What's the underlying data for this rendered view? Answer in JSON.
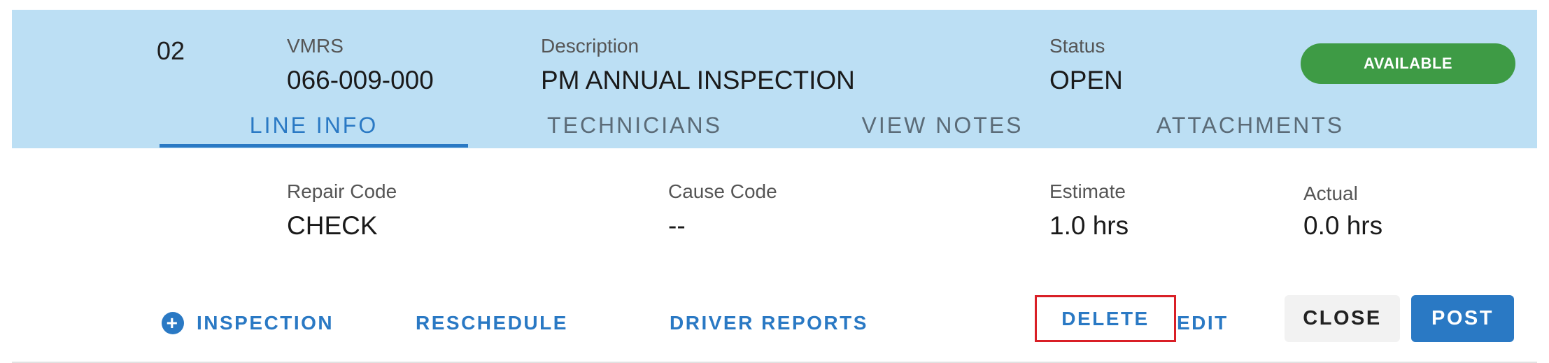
{
  "line": {
    "number": "02",
    "vmrs_label": "VMRS",
    "vmrs_value": "066-009-000",
    "description_label": "Description",
    "description_value": "PM ANNUAL INSPECTION",
    "status_label": "Status",
    "status_value": "OPEN",
    "availability_badge": "AVAILABLE"
  },
  "tabs": [
    {
      "label": "LINE INFO",
      "active": true
    },
    {
      "label": "TECHNICIANS",
      "active": false
    },
    {
      "label": "VIEW NOTES",
      "active": false
    },
    {
      "label": "ATTACHMENTS",
      "active": false
    }
  ],
  "details": {
    "repair_code_label": "Repair Code",
    "repair_code_value": "CHECK",
    "cause_code_label": "Cause Code",
    "cause_code_value": "--",
    "estimate_label": "Estimate",
    "estimate_value": "1.0 hrs",
    "actual_label": "Actual",
    "actual_value": "0.0 hrs"
  },
  "actions": {
    "inspection": "INSPECTION",
    "reschedule": "RESCHEDULE",
    "driver_reports": "DRIVER REPORTS",
    "delete": "DELETE",
    "edit": "EDIT",
    "close": "CLOSE",
    "post": "POST"
  },
  "colors": {
    "header_background": "#bcdff4",
    "accent": "#2a79c4",
    "badge_green": "#3e9b45",
    "highlight_red": "#d91f26"
  },
  "icons": {
    "inspection_add": "plus-circle-icon"
  }
}
